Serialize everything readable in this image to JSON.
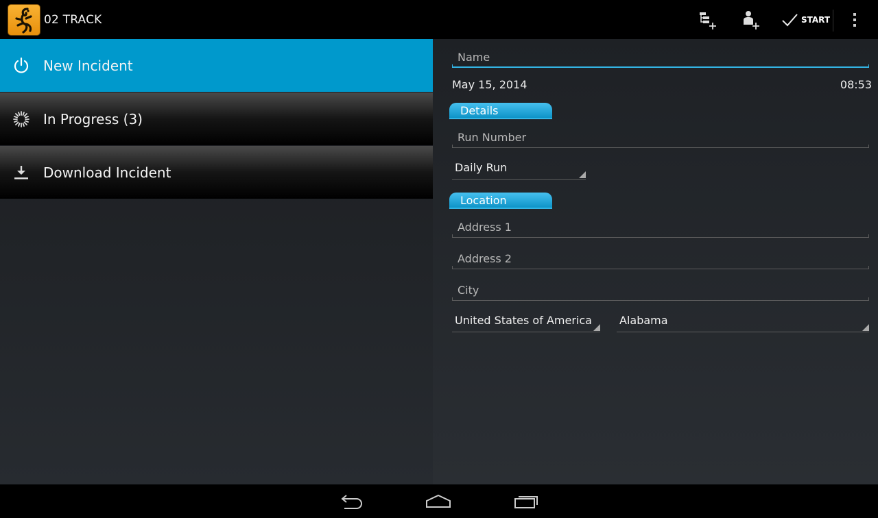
{
  "actionbar": {
    "app_title": "02 TRACK",
    "actions": [
      {
        "icon": "add-hierarchy-icon"
      },
      {
        "icon": "add-person-icon"
      },
      {
        "icon": "checkmark-icon",
        "label": "START"
      },
      {
        "icon": "overflow-menu-icon"
      }
    ]
  },
  "sidebar": {
    "items": [
      {
        "label": "New Incident",
        "icon": "power-icon",
        "selected": true
      },
      {
        "label": "In Progress (3)",
        "icon": "spinner-icon",
        "selected": false
      },
      {
        "label": "Download Incident",
        "icon": "download-icon",
        "selected": false
      }
    ]
  },
  "form": {
    "name_placeholder": "Name",
    "date": "May 15, 2014",
    "time": "08:53",
    "details_header": "Details",
    "run_number_placeholder": "Run Number",
    "run_type": "Daily Run",
    "location_header": "Location",
    "address1_placeholder": "Address 1",
    "address2_placeholder": "Address 2",
    "city_placeholder": "City",
    "country": "United States of America",
    "state": "Alabama"
  },
  "colors": {
    "accent": "#33b5e5",
    "selected_item": "#0099cc",
    "logo": "#f5a623"
  },
  "navbar": {
    "buttons": [
      "back-icon",
      "home-icon",
      "recent-apps-icon"
    ]
  }
}
